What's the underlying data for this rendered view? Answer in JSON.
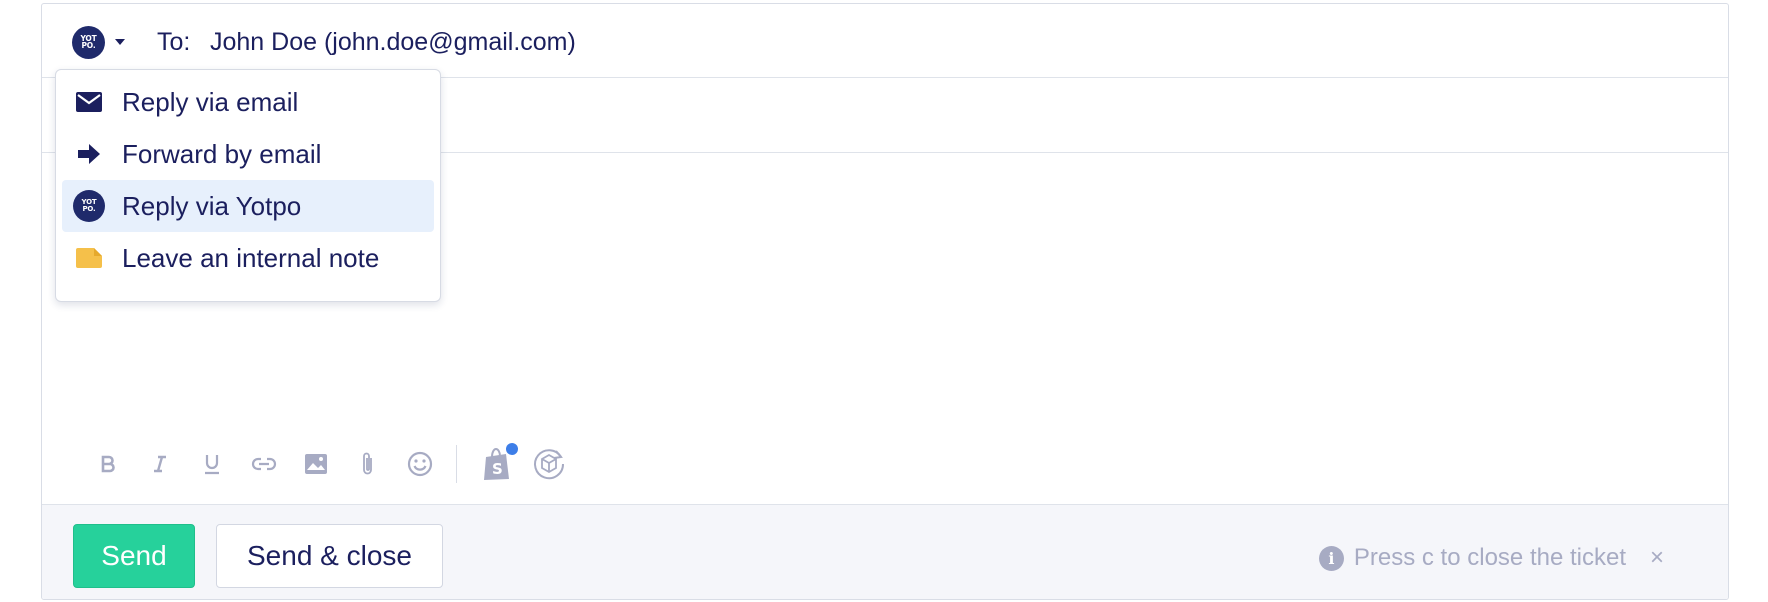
{
  "recipient": {
    "label": "To:",
    "value": "John Doe (john.doe@gmail.com)"
  },
  "channel_selector": {
    "icon": "yotpo-logo",
    "logo_text_line1": "YOT",
    "logo_text_line2": "PO."
  },
  "channel_menu": {
    "items": [
      {
        "label": "Reply via email",
        "icon": "envelope-icon"
      },
      {
        "label": "Forward by email",
        "icon": "forward-arrow-icon"
      },
      {
        "label": "Reply via Yotpo",
        "icon": "yotpo-logo",
        "selected": true
      },
      {
        "label": "Leave an internal note",
        "icon": "note-icon"
      }
    ]
  },
  "toolbar": {
    "tools": [
      "bold-icon",
      "italic-icon",
      "underline-icon",
      "link-icon",
      "image-icon",
      "attachment-icon",
      "emoji-icon",
      "shopify-icon",
      "order-return-icon"
    ]
  },
  "footer": {
    "send_label": "Send",
    "send_close_label": "Send & close",
    "hint": "Press c to close the ticket",
    "hint_close": "×"
  },
  "colors": {
    "send_green": "#26d19b",
    "text_navy": "#1b1f5e",
    "selected_bg": "#e7f0fc",
    "note_yellow": "#f5c04a",
    "notification_blue": "#3d7ee8"
  }
}
